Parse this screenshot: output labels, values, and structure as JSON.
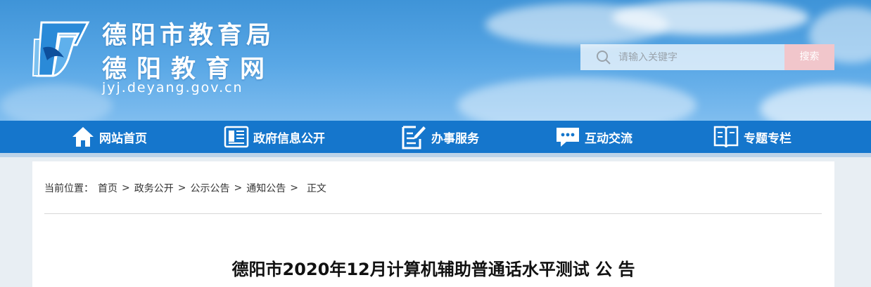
{
  "header": {
    "title_line1": "德阳市教育局",
    "title_line2": "德阳教育网",
    "url": "jyj.deyang.gov.cn"
  },
  "search": {
    "placeholder": "请输入关键字",
    "button_label": "搜索"
  },
  "nav": {
    "items": [
      {
        "label": "网站首页",
        "icon": "home-icon"
      },
      {
        "label": "政府信息公开",
        "icon": "newspaper-icon"
      },
      {
        "label": "办事服务",
        "icon": "edit-document-icon"
      },
      {
        "label": "互动交流",
        "icon": "chat-icon"
      },
      {
        "label": "专题专栏",
        "icon": "book-icon"
      }
    ]
  },
  "breadcrumb": {
    "prefix": "当前位置：",
    "items": [
      "首页",
      "政务公开",
      "公示公告",
      "通知公告",
      "正文"
    ],
    "separator": ">"
  },
  "article": {
    "title": "德阳市2020年12月计算机辅助普通话水平测试 公 告"
  },
  "colors": {
    "nav_bg": "#1576cc",
    "search_button": "#f1c6cb",
    "header_sky": "#5aa8e6"
  }
}
